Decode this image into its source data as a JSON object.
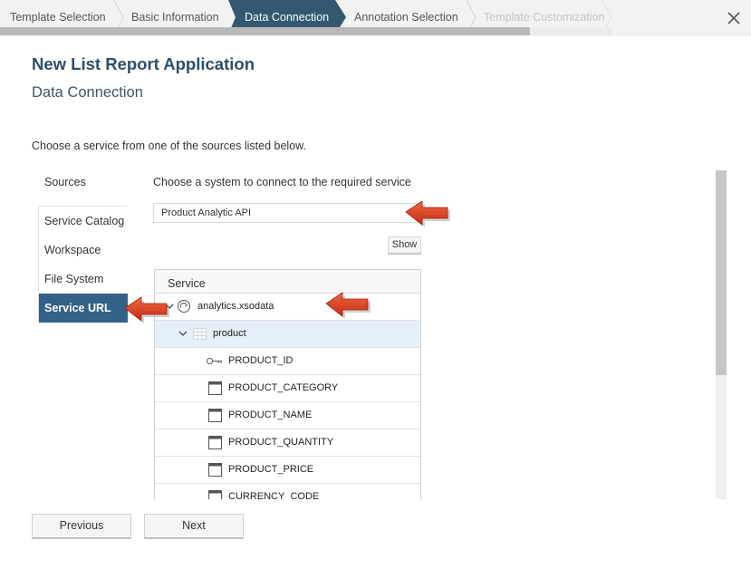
{
  "wizard": {
    "steps": [
      {
        "label": "Template Selection",
        "state": "completed"
      },
      {
        "label": "Basic Information",
        "state": "completed"
      },
      {
        "label": "Data Connection",
        "state": "active"
      },
      {
        "label": "Annotation Selection",
        "state": "upcoming"
      },
      {
        "label": "Template Customization",
        "state": "disabled"
      }
    ],
    "progress_fraction": 0.865,
    "close_icon": "close-icon",
    "active_color": "#33586f"
  },
  "header": {
    "app_title": "New List Report Application",
    "subtitle": "Data Connection"
  },
  "instruction": "Choose a service from one of the sources listed below.",
  "sources": {
    "heading": "Sources",
    "items": [
      {
        "label": "Service Catalog",
        "selected": false
      },
      {
        "label": "Workspace",
        "selected": false
      },
      {
        "label": "File System",
        "selected": false
      },
      {
        "label": "Service URL",
        "selected": true
      }
    ],
    "selected_color": "#346187"
  },
  "system": {
    "heading": "Choose a system to connect to the required service",
    "selected_value": "Product Analytic API",
    "show_button": "Show"
  },
  "service_tree": {
    "column_header": "Service",
    "rows": [
      {
        "label": "analytics.xsodata",
        "level": 0,
        "icon": "service-icon",
        "expanded": true
      },
      {
        "label": "product",
        "level": 1,
        "icon": "entity-set-icon",
        "expanded": true,
        "selected": true
      },
      {
        "label": "PRODUCT_ID",
        "level": 2,
        "icon": "key-icon"
      },
      {
        "label": "PRODUCT_CATEGORY",
        "level": 2,
        "icon": "property-icon"
      },
      {
        "label": "PRODUCT_NAME",
        "level": 2,
        "icon": "property-icon"
      },
      {
        "label": "PRODUCT_QUANTITY",
        "level": 2,
        "icon": "property-icon"
      },
      {
        "label": "PRODUCT_PRICE",
        "level": 2,
        "icon": "property-icon"
      },
      {
        "label": "CURRENCY_CODE",
        "level": 2,
        "icon": "property-icon"
      }
    ]
  },
  "footer": {
    "previous": "Previous",
    "next": "Next"
  },
  "annotations": {
    "arrow_color": "#d93a1f"
  }
}
